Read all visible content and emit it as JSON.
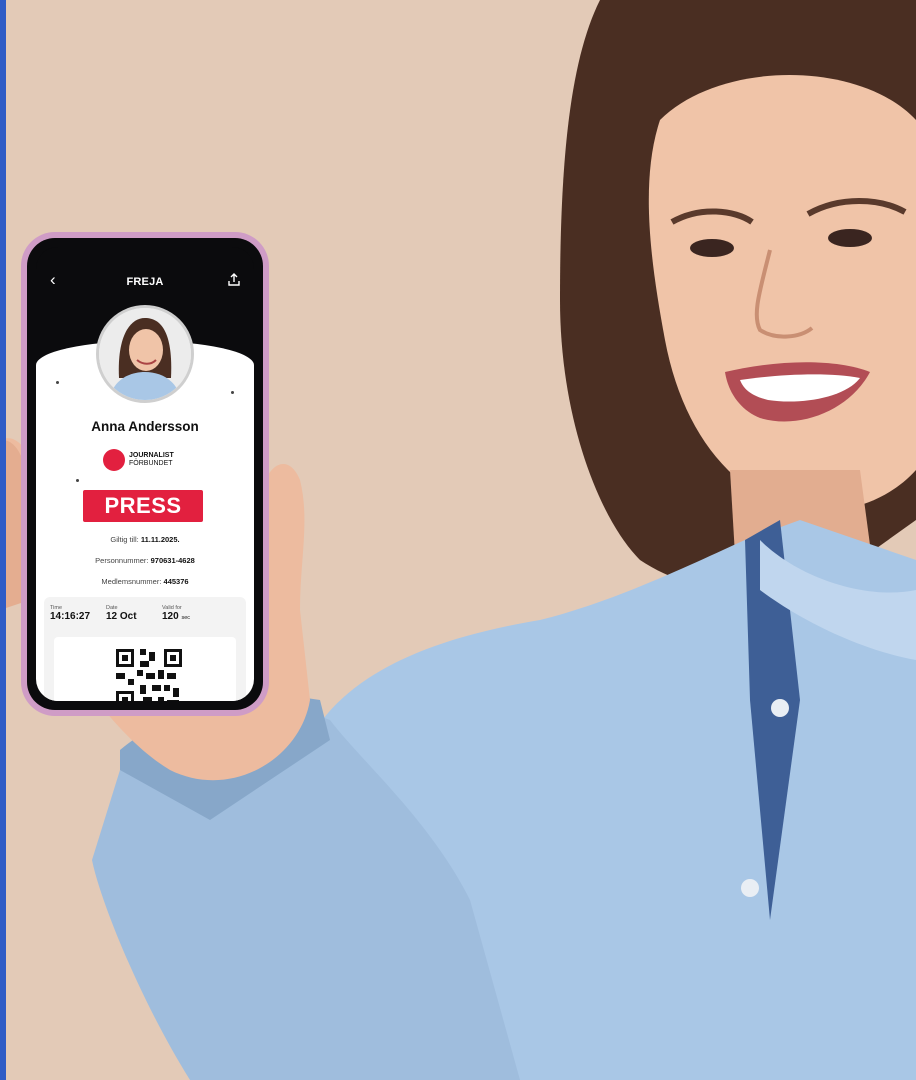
{
  "scene": {
    "description_free": true,
    "icons": [
      "back-icon",
      "share-icon",
      "journalist-logo-icon",
      "qr-code-icon"
    ],
    "colors": {
      "accent": "#e2203f",
      "phone_frame": "#cf9cc6",
      "background": "#e3cab7",
      "shirt": "#a9c7e6",
      "left_edge": "#2f5cc6"
    }
  },
  "app": {
    "title": "FREJA",
    "name": "Anna Andersson",
    "logo": {
      "line1": "JOURNALIST",
      "line2": "FÖRBUNDET"
    },
    "badge": "PRESS",
    "fields": [
      {
        "label": "Giltig till:",
        "value": "11.11.2025."
      },
      {
        "label": "Personnummer:",
        "value": "970631-4628"
      },
      {
        "label": "Medlemsnummer:",
        "value": "445376"
      }
    ],
    "panel": {
      "time_label": "Time",
      "time_value": "14:16:27",
      "date_label": "Date",
      "date_value": "12 Oct",
      "valid_label": "Valid for",
      "valid_value": "120",
      "valid_unit": "sec"
    }
  }
}
